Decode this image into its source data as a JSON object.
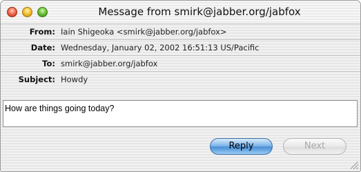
{
  "window": {
    "title": "Message from smirk@jabber.org/jabfox"
  },
  "headers": [
    {
      "label": "From:",
      "value": "Iain Shigeoka <smirk@jabber.org/jabfox>"
    },
    {
      "label": "Date:",
      "value": "Wednesday, January 02, 2002 16:51:13 US/Pacific"
    },
    {
      "label": "To:",
      "value": "smirk@jabber.org/jabfox"
    },
    {
      "label": "Subject:",
      "value": "Howdy"
    }
  ],
  "message": {
    "body": "How are things going today?"
  },
  "buttons": {
    "reply_label": "Reply",
    "next_label": "Next"
  },
  "icons": {
    "close": "close-icon",
    "minimize": "minimize-icon",
    "zoom": "zoom-icon",
    "resize": "resize-grip-icon"
  },
  "colors": {
    "close": "#f06a4f",
    "minimize": "#f5c132",
    "zoom": "#71c43b",
    "default_button": "#4b8fd6",
    "disabled_text": "#a9a9a9"
  }
}
